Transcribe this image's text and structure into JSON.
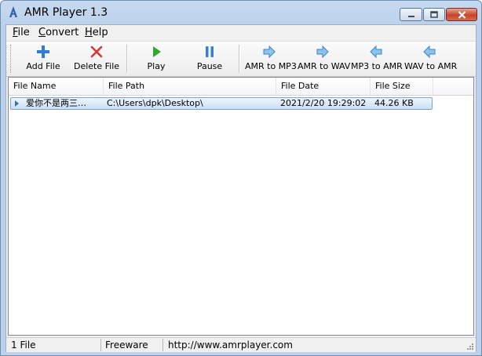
{
  "window": {
    "title": "AMR Player 1.3"
  },
  "title_controls": [
    "minimize",
    "maximize",
    "close"
  ],
  "menu": [
    {
      "label": "File",
      "mnemonic": "F",
      "rest": "ile"
    },
    {
      "label": "Convert",
      "mnemonic": "C",
      "rest": "onvert"
    },
    {
      "label": "Help",
      "mnemonic": "H",
      "rest": "elp"
    }
  ],
  "toolbar": {
    "add_file": {
      "label": "Add File",
      "icon": "plus-icon",
      "color": "#2f7bd6"
    },
    "delete_file": {
      "label": "Delete File",
      "icon": "x-icon",
      "color": "#d43a2f"
    },
    "play": {
      "label": "Play",
      "icon": "play-icon",
      "color": "#2fa82f"
    },
    "pause": {
      "label": "Pause",
      "icon": "pause-icon",
      "color": "#3a7fc9"
    },
    "amr_to_mp3": {
      "label": "AMR to MP3",
      "icon": "arrow-right-icon"
    },
    "amr_to_wav": {
      "label": "AMR to WAV",
      "icon": "arrow-right-icon"
    },
    "mp3_to_amr": {
      "label": "MP3 to AMR",
      "icon": "arrow-left-icon"
    },
    "wav_to_amr": {
      "label": "WAV to AMR",
      "icon": "arrow-left-icon"
    }
  },
  "list": {
    "columns": [
      "File Name",
      "File Path",
      "File Date",
      "File Size"
    ],
    "rows": [
      {
        "name": "爱你不是两三…",
        "path": "C:\\Users\\dpk\\Desktop\\",
        "date": "2021/2/20 19:29:02",
        "size": "44.26 KB"
      }
    ]
  },
  "status": {
    "count": "1 File",
    "license": "Freeware",
    "url": "http://www.amrplayer.com"
  },
  "colors": {
    "accent": "#3a7fc9",
    "selection": "#c9dff7"
  }
}
